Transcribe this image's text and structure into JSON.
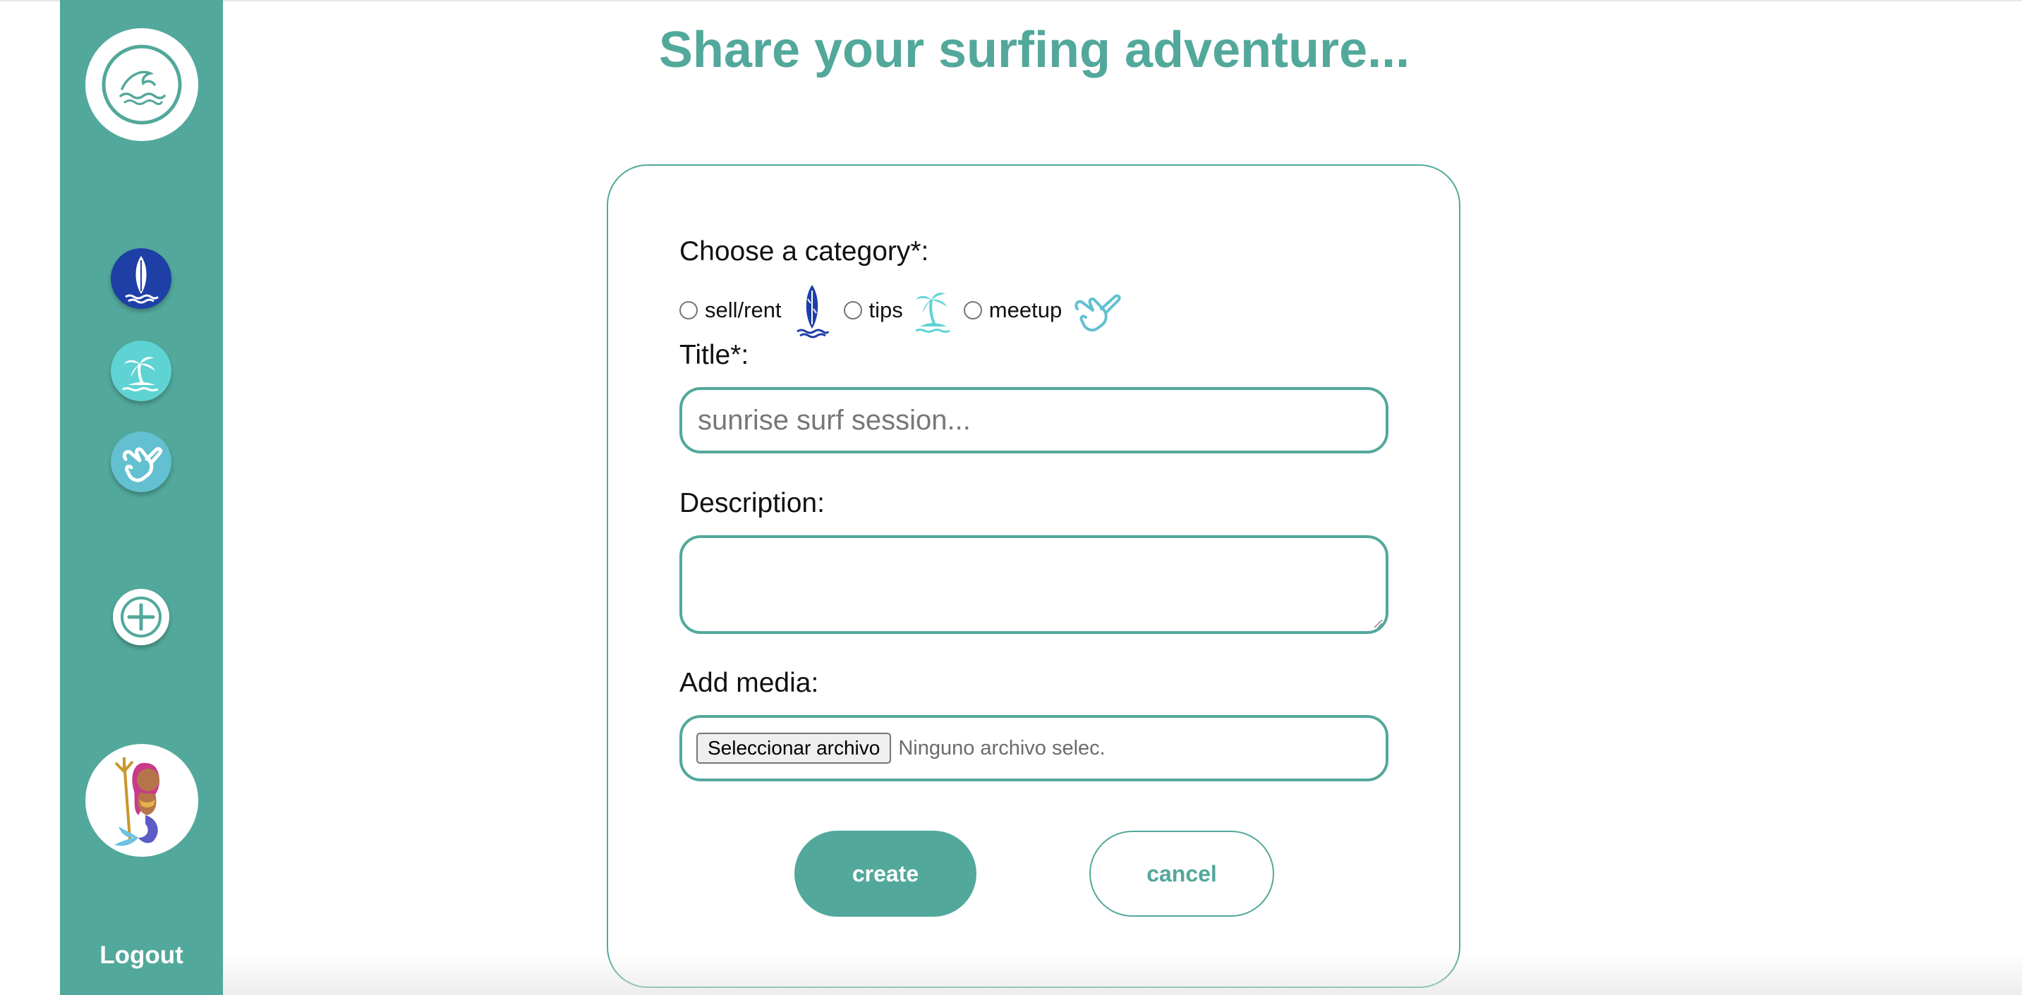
{
  "page": {
    "title": "Share your surfing adventure..."
  },
  "sidebar": {
    "logo_icon": "wave-icon",
    "items": [
      {
        "name": "sell-rent",
        "icon": "surfboard-icon",
        "color": "#1e3fa6"
      },
      {
        "name": "tips",
        "icon": "palm-island-icon",
        "color": "#5fd3d3"
      },
      {
        "name": "meetup",
        "icon": "shaka-hand-icon",
        "color": "#62c0d0"
      }
    ],
    "add_icon": "plus-icon",
    "avatar": "mermaid-avatar",
    "logout_label": "Logout",
    "background": "#52a89b"
  },
  "form": {
    "category_label": "Choose a category*:",
    "categories": [
      {
        "label": "sell/rent",
        "icon": "surfboard-icon"
      },
      {
        "label": "tips",
        "icon": "palm-island-icon"
      },
      {
        "label": "meetup",
        "icon": "shaka-hand-icon"
      }
    ],
    "title_label": "Title*:",
    "title_placeholder": "sunrise surf session...",
    "description_label": "Description:",
    "description_value": "",
    "media_label": "Add media:",
    "file_button_label": "Seleccionar archivo",
    "file_status": "Ninguno archivo selec.",
    "create_label": "create",
    "cancel_label": "cancel"
  },
  "colors": {
    "accent": "#52a89b",
    "surfboard": "#1e3fa6",
    "tips": "#5fd3d3",
    "meetup": "#62c0d0"
  }
}
